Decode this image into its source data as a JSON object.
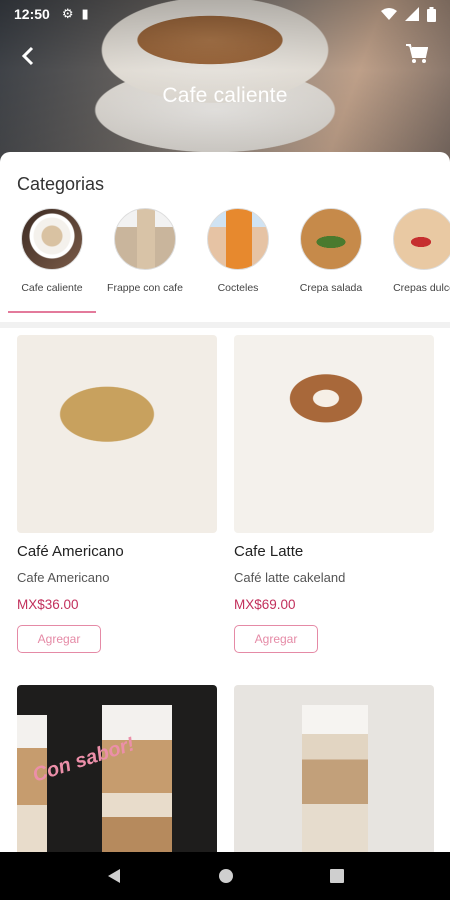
{
  "status_bar": {
    "time": "12:50",
    "left_icons": [
      "gear-icon",
      "sd-card-icon"
    ],
    "right_icons": [
      "wifi-icon",
      "signal-icon",
      "battery-icon"
    ]
  },
  "header": {
    "title": "Cafe caliente",
    "back_icon": "arrow-left-icon",
    "cart_icon": "cart-icon"
  },
  "categories": {
    "heading": "Categorias",
    "items": [
      {
        "label": "Cafe caliente",
        "selected": true
      },
      {
        "label": "Frappe con cafe",
        "selected": false
      },
      {
        "label": "Cocteles",
        "selected": false
      },
      {
        "label": "Crepa salada",
        "selected": false
      },
      {
        "label": "Crepas dulce",
        "selected": false
      }
    ],
    "accent_color": "#e37a9b"
  },
  "products": [
    {
      "name": "Café Americano",
      "description": "Cafe Americano",
      "price": "MX$36.00",
      "button": "Agregar"
    },
    {
      "name": "Cafe Latte",
      "description": "Café latte cakeland",
      "price": "MX$69.00",
      "button": "Agregar"
    },
    {
      "image_text": "Con sabor!"
    },
    {}
  ],
  "nav_bar": {
    "icons": [
      "back-triangle-icon",
      "home-circle-icon",
      "recents-square-icon"
    ]
  },
  "colors": {
    "price": "#c2305c",
    "button": "#e58aa6"
  }
}
